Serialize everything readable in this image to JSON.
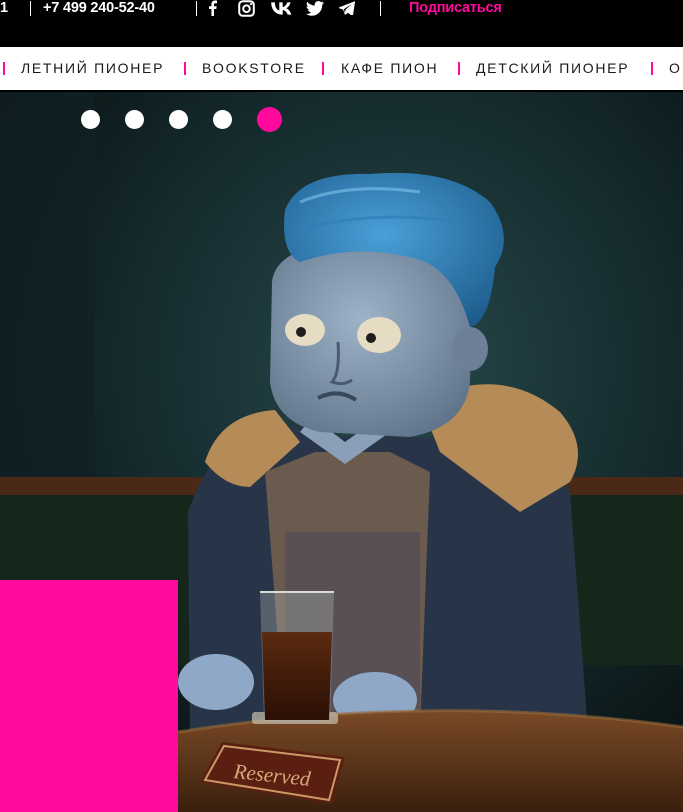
{
  "topbar": {
    "cut_text": "1",
    "phone": "+7 499 240-52-40",
    "social_icons": [
      "facebook-icon",
      "instagram-icon",
      "vk-icon",
      "twitter-icon",
      "telegram-icon"
    ],
    "subscribe_label": "Подписаться"
  },
  "nav": {
    "items": [
      {
        "label": "ЛЕТНИЙ ПИОНЕР"
      },
      {
        "label": "BOOKSTORE"
      },
      {
        "label": "КАФЕ ПИОН"
      },
      {
        "label": "ДЕТСКИЙ ПИОНЕР"
      },
      {
        "label": "О"
      }
    ]
  },
  "slider": {
    "dots_count": 5,
    "active_index": 4
  },
  "hero": {
    "sign_text": "Reserved"
  },
  "colors": {
    "accent": "#ff0a9c",
    "background": "#000000",
    "nav_background": "#ffffff"
  }
}
